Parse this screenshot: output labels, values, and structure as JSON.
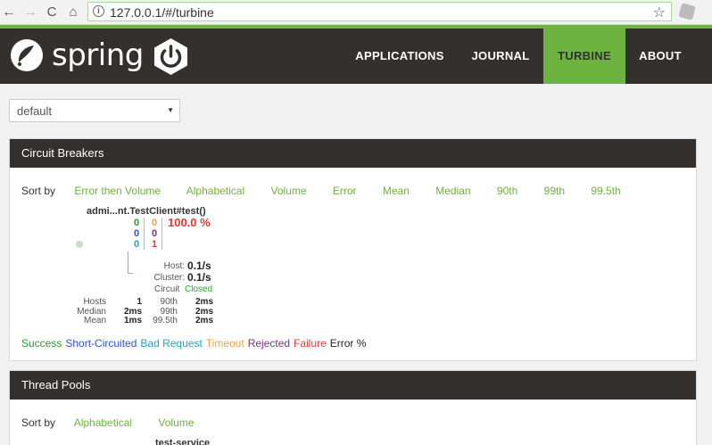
{
  "browser": {
    "url": "127.0.0.1/#/turbine",
    "back_glyph": "←",
    "forward_glyph": "→",
    "reload_glyph": "C",
    "home_glyph": "⌂",
    "info_glyph": "i",
    "star_glyph": "☆"
  },
  "header": {
    "logo_text": "spring",
    "nav": {
      "applications": "APPLICATIONS",
      "journal": "JOURNAL",
      "turbine": "TURBINE",
      "about": "ABOUT"
    },
    "colors": {
      "bar": "#34302d",
      "accent": "#6db33f"
    }
  },
  "cluster_select": {
    "value": "default",
    "caret": "▼"
  },
  "circuit_breakers": {
    "title": "Circuit Breakers",
    "sort_label": "Sort by",
    "sort_options": [
      "Error then Volume",
      "Alphabetical",
      "Volume",
      "Error",
      "Mean",
      "Median",
      "90th",
      "99th",
      "99.5th"
    ],
    "circuit": {
      "name": "admi...nt.TestClient#test()",
      "counts": {
        "success": "0",
        "short_circuited": "0",
        "bad_request": "0",
        "timeout": "0",
        "rejected": "0",
        "failure": "1"
      },
      "error_rate": "100.0 %",
      "host_label": "Host:",
      "host_rate": "0.1/s",
      "cluster_label": "Cluster:",
      "cluster_rate": "0.1/s",
      "circuit_label": "Circuit",
      "circuit_status": "Closed",
      "stats": {
        "hosts_label": "Hosts",
        "hosts": "1",
        "median_label": "Median",
        "median": "2ms",
        "mean_label": "Mean",
        "mean": "1ms",
        "p90_label": "90th",
        "p90": "2ms",
        "p99_label": "99th",
        "p99": "2ms",
        "p995_label": "99.5th",
        "p995": "2ms"
      }
    },
    "legend": {
      "success": "Success",
      "short_circuited": "Short-Circuited",
      "bad_request": "Bad Request",
      "timeout": "Timeout",
      "rejected": "Rejected",
      "failure": "Failure",
      "error_pct": "Error %"
    },
    "legend_colors": {
      "success": "#2a9d2a",
      "short_circuited": "#2b52d8",
      "bad_request": "#21a7c0",
      "timeout": "#f2a33a",
      "rejected": "#8b2a8b",
      "failure": "#e33",
      "error_pct": "#222"
    }
  },
  "thread_pools": {
    "title": "Thread Pools",
    "sort_label": "Sort by",
    "sort_options": [
      "Alphabetical",
      "Volume"
    ],
    "pool_name": "test-service"
  }
}
